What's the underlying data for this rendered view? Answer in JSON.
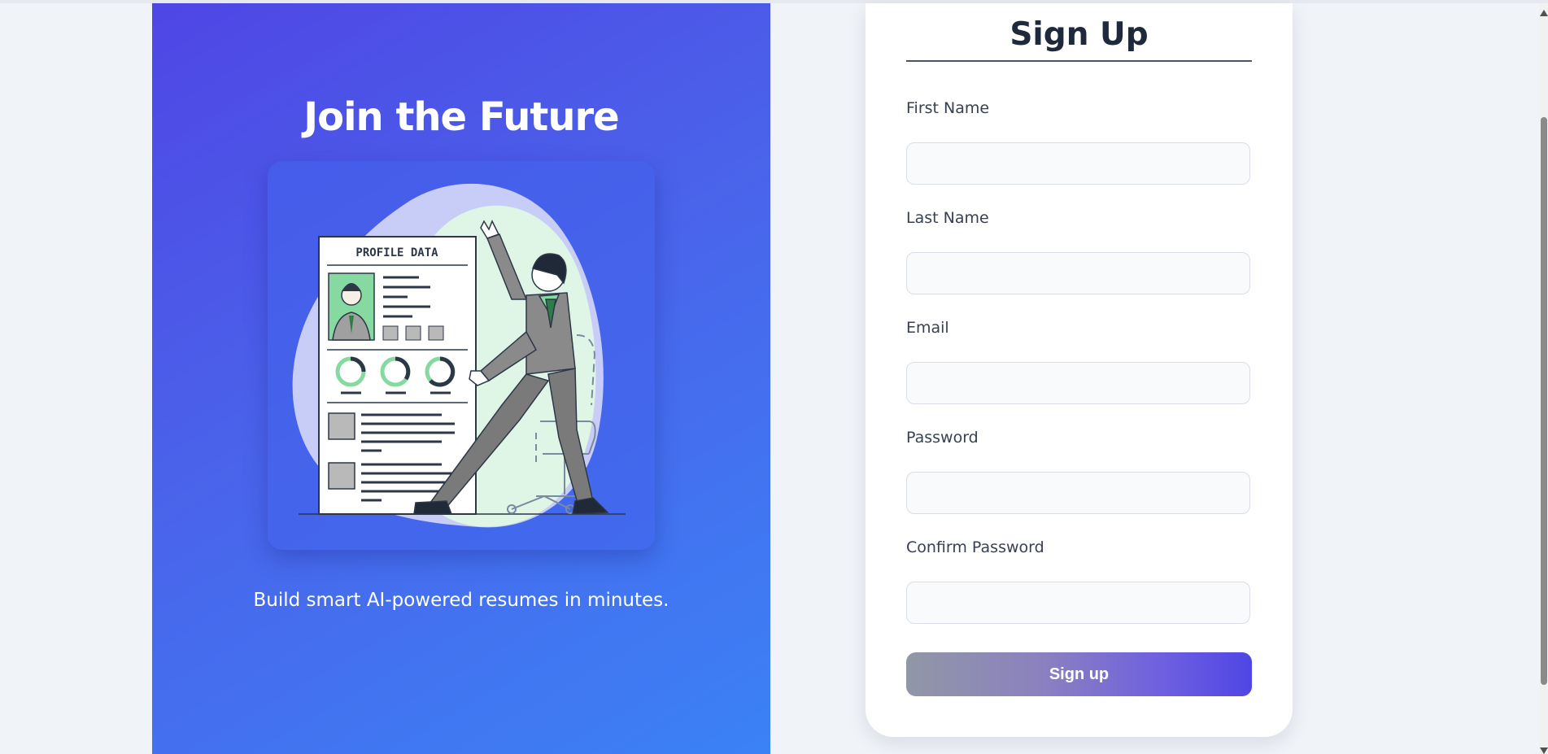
{
  "hero": {
    "title": "Join the Future",
    "illustration": {
      "profile_card_title": "PROFILE DATA",
      "icon": "resume-presentation-illustration"
    },
    "tagline": "Build smart AI-powered resumes in minutes."
  },
  "form": {
    "title": "Sign Up",
    "fields": [
      {
        "label": "First Name",
        "value": "",
        "placeholder": ""
      },
      {
        "label": "Last Name",
        "value": "",
        "placeholder": ""
      },
      {
        "label": "Email",
        "value": "",
        "placeholder": ""
      },
      {
        "label": "Password",
        "value": "",
        "placeholder": ""
      },
      {
        "label": "Confirm Password",
        "value": "",
        "placeholder": ""
      }
    ],
    "submit_label": "Sign up"
  },
  "colors": {
    "hero_gradient_start": "#4f46e5",
    "hero_gradient_end": "#3b82f6",
    "button_gradient_start": "#9197a6",
    "button_gradient_end": "#4f46e5",
    "title_text": "#1e293b",
    "illustration_green": "#86d9a0"
  }
}
